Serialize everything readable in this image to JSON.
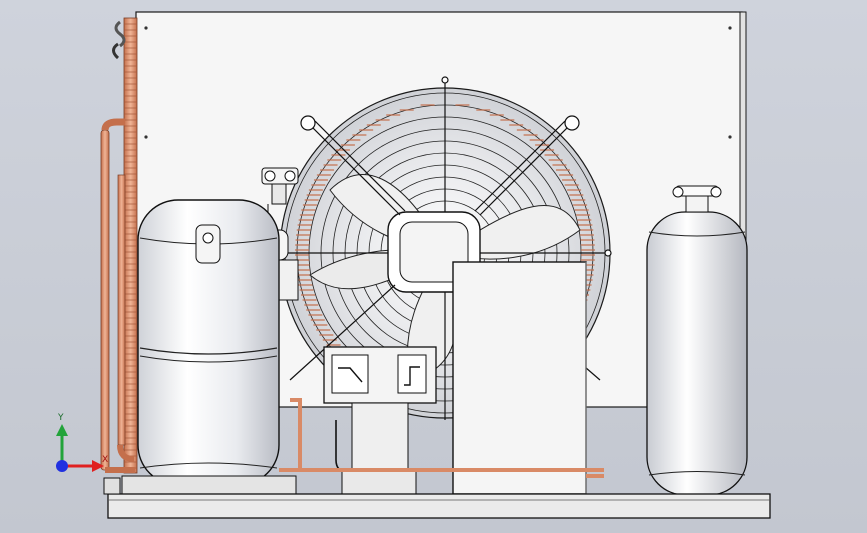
{
  "viewport": {
    "background_top": "#cfd3dc",
    "background_bottom": "#c3c7d0"
  },
  "triad": {
    "y_label": "Y",
    "x_label": "X",
    "y_color": "#22a33a",
    "x_color": "#e02020",
    "z_color": "#2030e0"
  },
  "model": {
    "parts": [
      "condenser-panel",
      "condenser-coil",
      "axial-fan",
      "fan-guard",
      "scroll-compressor",
      "liquid-receiver",
      "pressure-switch",
      "electrical-box",
      "base-frame",
      "service-valve"
    ],
    "copper_color": "#d98a66",
    "steel_color": "#f2f2f2",
    "outline_color": "#1a1a1a"
  }
}
